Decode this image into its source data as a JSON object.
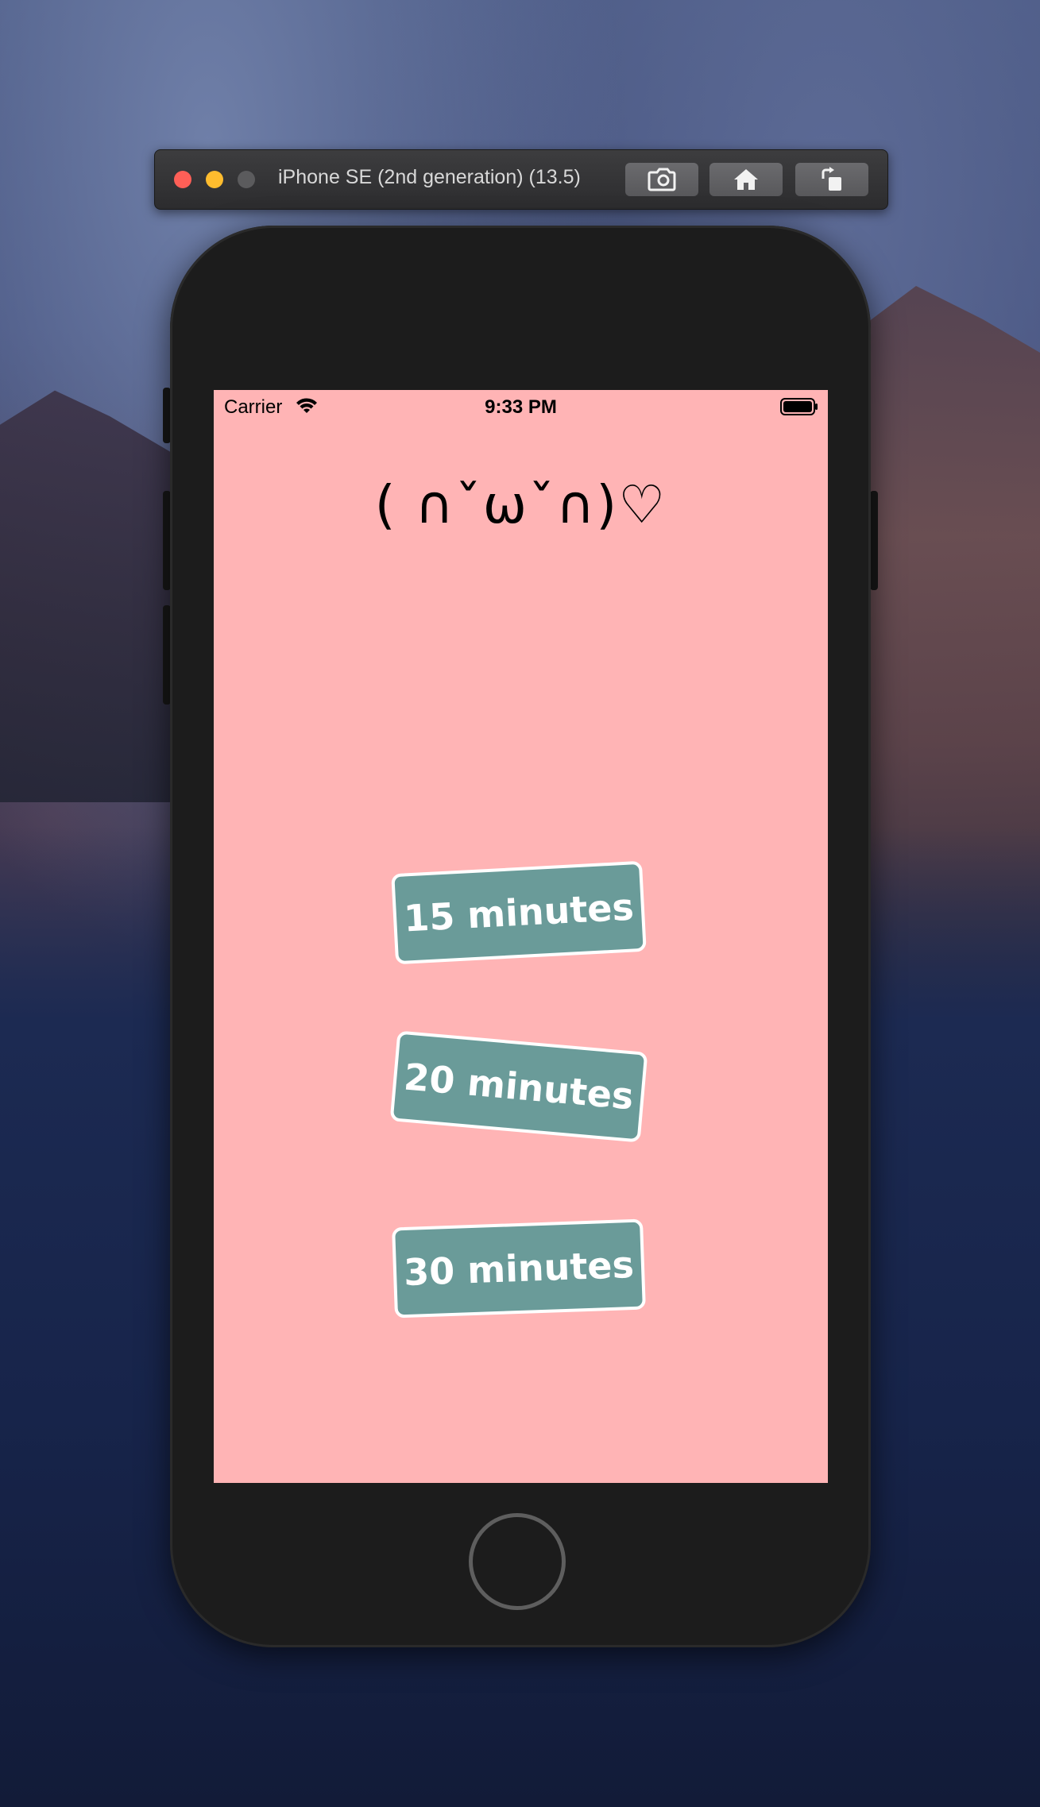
{
  "simulator": {
    "title": "iPhone SE (2nd generation) (13.5)",
    "buttons": {
      "screenshot_icon": "camera-icon",
      "home_icon": "home-icon",
      "rotate_icon": "rotate-icon"
    }
  },
  "status_bar": {
    "carrier": "Carrier",
    "time": "9:33 PM"
  },
  "app": {
    "kaomoji": "( ∩ˇωˇ∩)♡",
    "background_color": "#ffb4b5",
    "button_color": "#6a9b99",
    "buttons": [
      {
        "label": "15 minutes"
      },
      {
        "label": "20 minutes"
      },
      {
        "label": "30 minutes"
      }
    ]
  }
}
